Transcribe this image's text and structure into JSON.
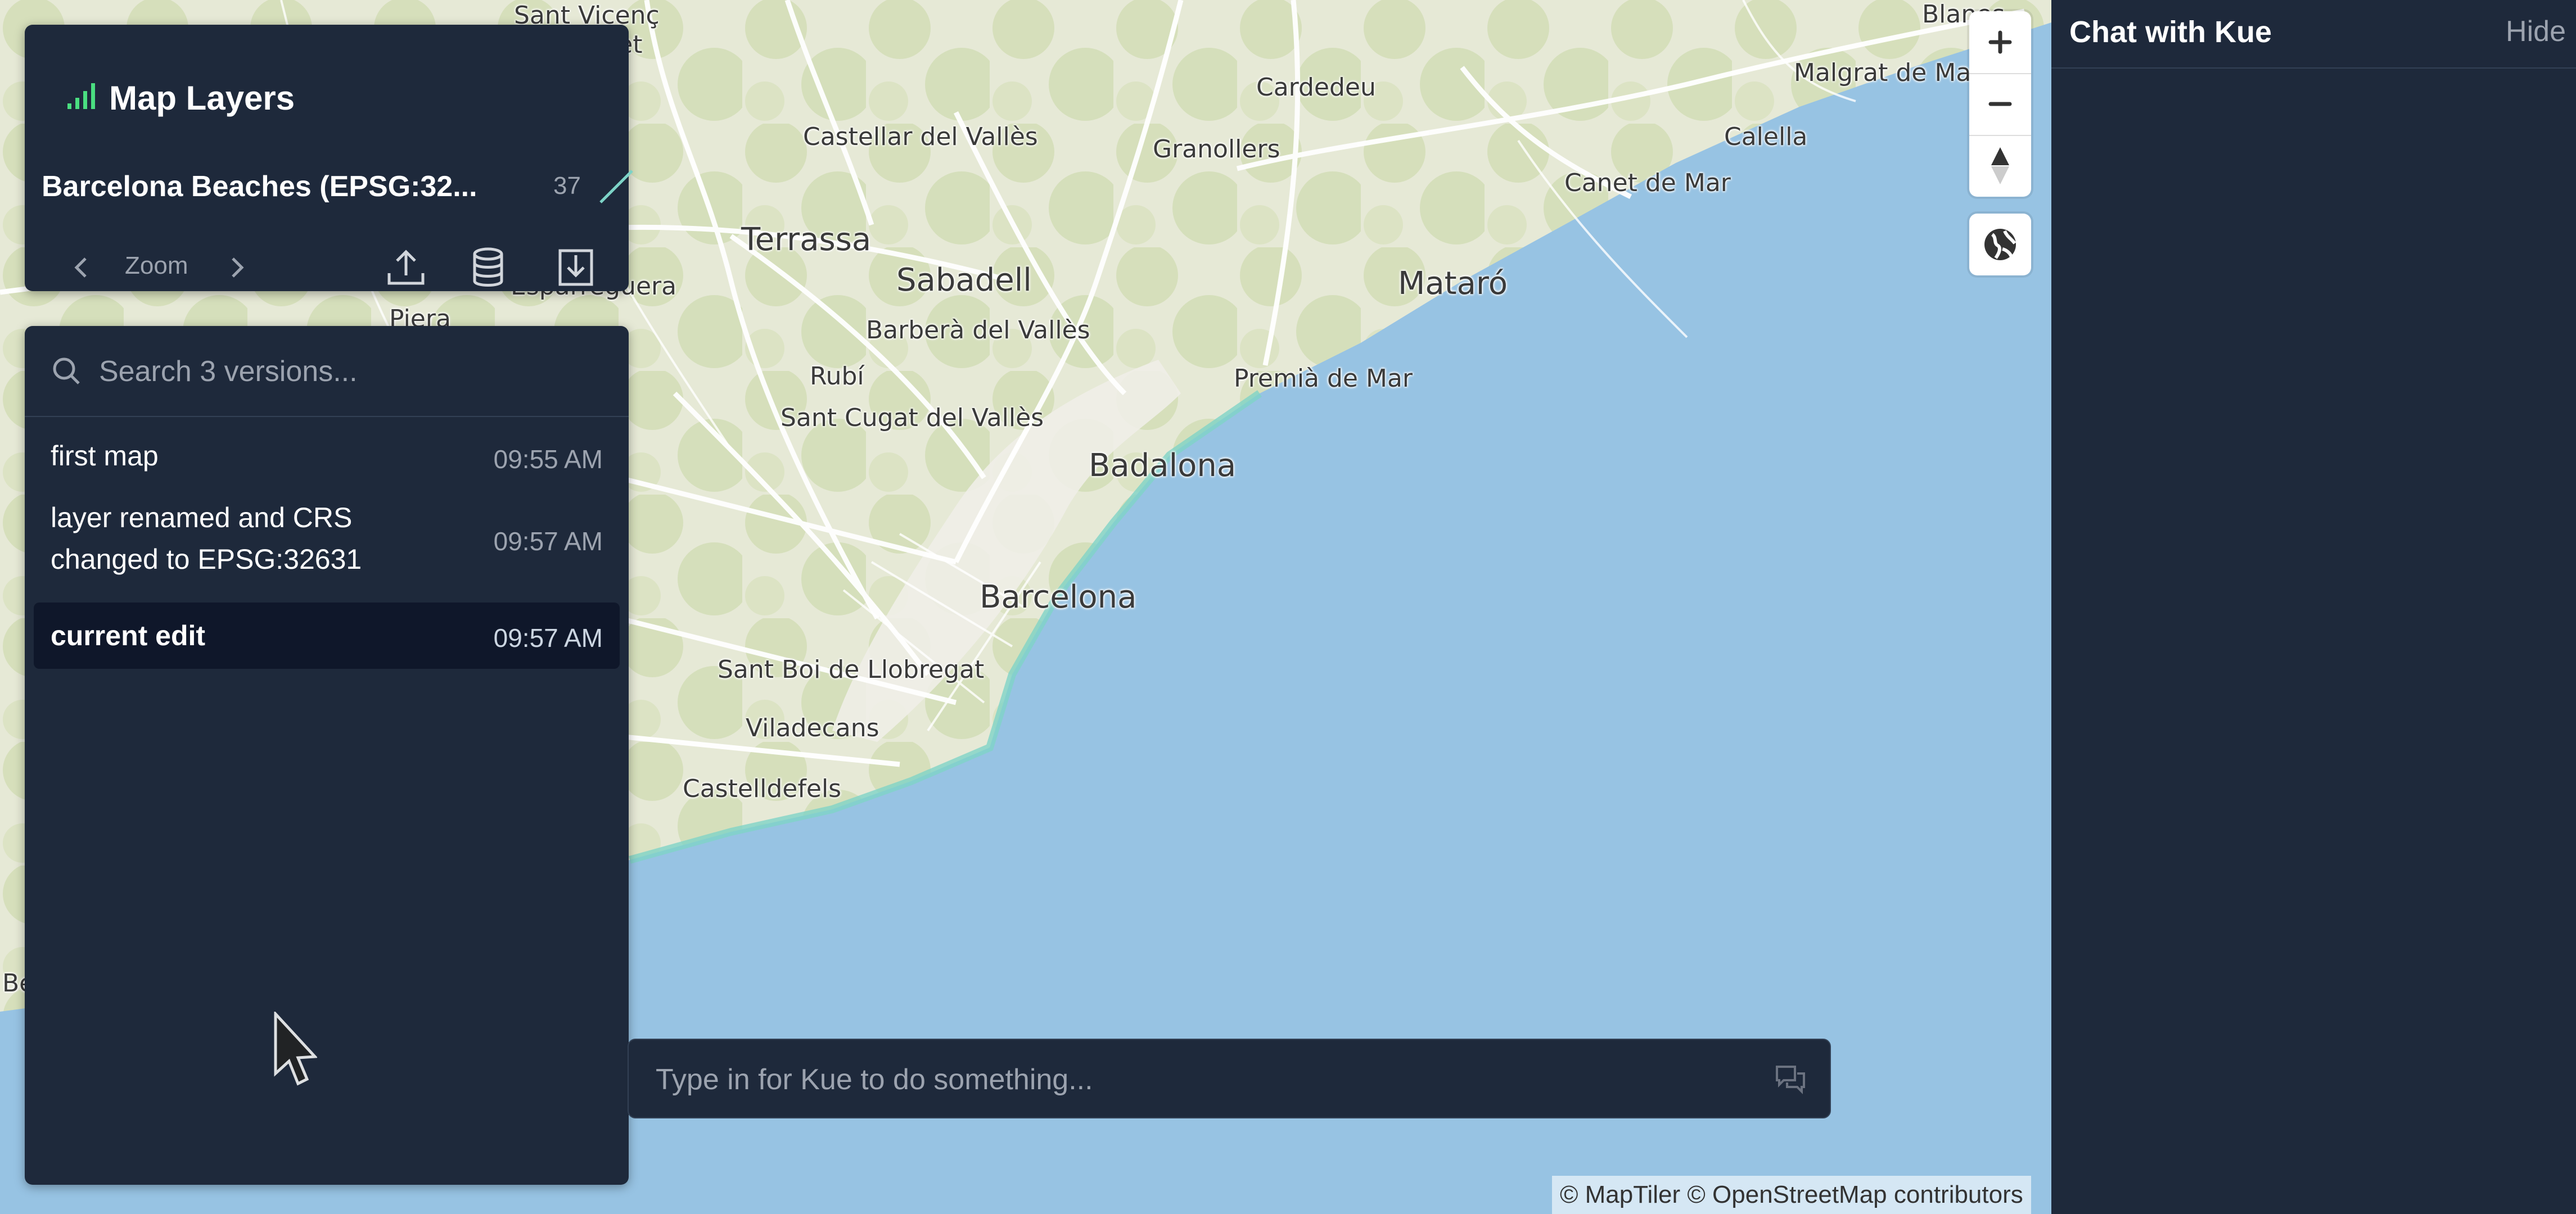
{
  "layers_panel": {
    "title": "Map Layers",
    "layer_name": "Barcelona Beaches (EPSG:32...",
    "layer_count": "37",
    "zoom_label": "Zoom"
  },
  "versions": {
    "search_placeholder": "Search 3 versions...",
    "items": [
      {
        "label": "first map",
        "time": "09:55 AM"
      },
      {
        "label": "layer renamed and CRS changed to EPSG:32631",
        "time": "09:57 AM"
      },
      {
        "label": "current edit",
        "time": "09:57 AM"
      }
    ]
  },
  "prompt": {
    "placeholder": "Type in for Kue to do something..."
  },
  "chat": {
    "title": "Chat with Kue",
    "hide_label": "Hide"
  },
  "map": {
    "attribution": "© MapTiler © OpenStreetMap contributors",
    "places": [
      "Sant Vicenç",
      "Blanes",
      "Cardedeu",
      "Malgrat de Ma",
      "Castellar del Vallès",
      "Granollers",
      "Calella",
      "Canet de Mar",
      "Terrassa",
      "Sabadell",
      "Mataró",
      "Barberà del Vallès",
      "Rubí",
      "Premià de Mar",
      "Sant Cugat del Vallès",
      "Badalona",
      "Barcelona",
      "Sant Boi de Llobregat",
      "Viladecans",
      "Castelldefels",
      "Esparreguera",
      "Piera",
      "Be",
      "let"
    ]
  },
  "colors": {
    "panel_bg": "#1e293b",
    "sea": "#97c3e3",
    "land": "#e9ecdc",
    "accent": "#4ade80"
  },
  "icons": [
    "signal-bars-icon",
    "line-style-icon",
    "chevron-left-icon",
    "chevron-right-icon",
    "upload-icon",
    "database-icon",
    "download-icon",
    "search-icon",
    "chat-bubbles-icon",
    "plus-icon",
    "minus-icon",
    "compass-icon",
    "globe-icon",
    "cursor-icon"
  ]
}
